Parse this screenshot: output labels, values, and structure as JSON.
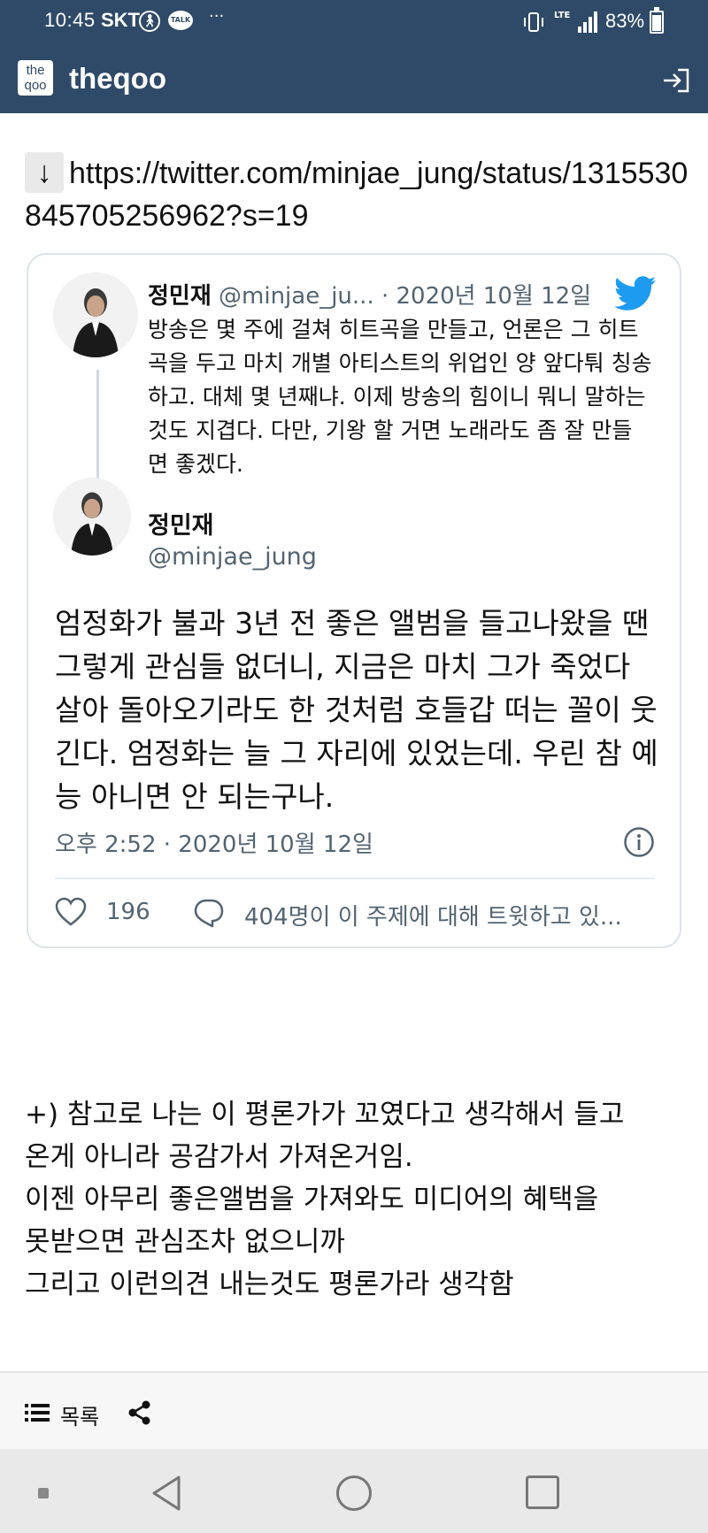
{
  "status_bar": {
    "time": "10:45",
    "carrier": "SKT",
    "talk_badge": "TALK",
    "more": "···",
    "network": "LTE",
    "battery": "83%",
    "battery_level": 0.83
  },
  "app": {
    "logo_text": "the qoo",
    "title": "theqoo",
    "accent_color": "#2f4a68"
  },
  "post": {
    "link_arrow": "↓",
    "link_url": "https://twitter.com/minjae_jung/status/1315530845705256962?s=19"
  },
  "tweet": {
    "quoted": {
      "name": "정민재",
      "handle": "@minjae_ju...",
      "date": "· 2020년 10월 12일",
      "body": "방송은 몇 주에 걸쳐 히트곡을 만들고, 언론은 그 히트곡을 두고 마치 개별 아티스트의 위업인 양 앞다퉈 칭송하고. 대체 몇 년째냐. 이제 방송의 힘이니 뭐니 말하는 것도 지겹다. 다만, 기왕 할 거면 노래라도 좀 잘 만들면 좋겠다."
    },
    "main": {
      "name": "정민재",
      "handle": "@minjae_jung",
      "body": "엄정화가 불과 3년 전 좋은 앨범을 들고나왔을 땐 그렇게 관심들 없더니, 지금은 마치 그가 죽었다 살아 돌아오기라도 한 것처럼 호들갑 떠는 꼴이 웃긴다. 엄정화는 늘 그 자리에 있었는데. 우린 참 예능 아니면 안 되는구나.",
      "timestamp": "오후 2:52 · 2020년 10월 12일",
      "likes": "196",
      "reply_text": "404명이 이 주제에 대해 트윗하고 있..."
    },
    "twitter_color": "#1d9bf0"
  },
  "note": {
    "lines": [
      "+) 참고로 나는 이 평론가가 꼬였다고 생각해서 들고",
      "온게 아니라 공감가서 가져온거임.",
      "이젠 아무리 좋은앨범을 가져와도 미디어의 혜택을",
      "못받으면 관심조차 없으니까",
      "그리고 이런의견 내는것도 평론가라 생각함"
    ]
  },
  "footer": {
    "list_label": "목록"
  }
}
